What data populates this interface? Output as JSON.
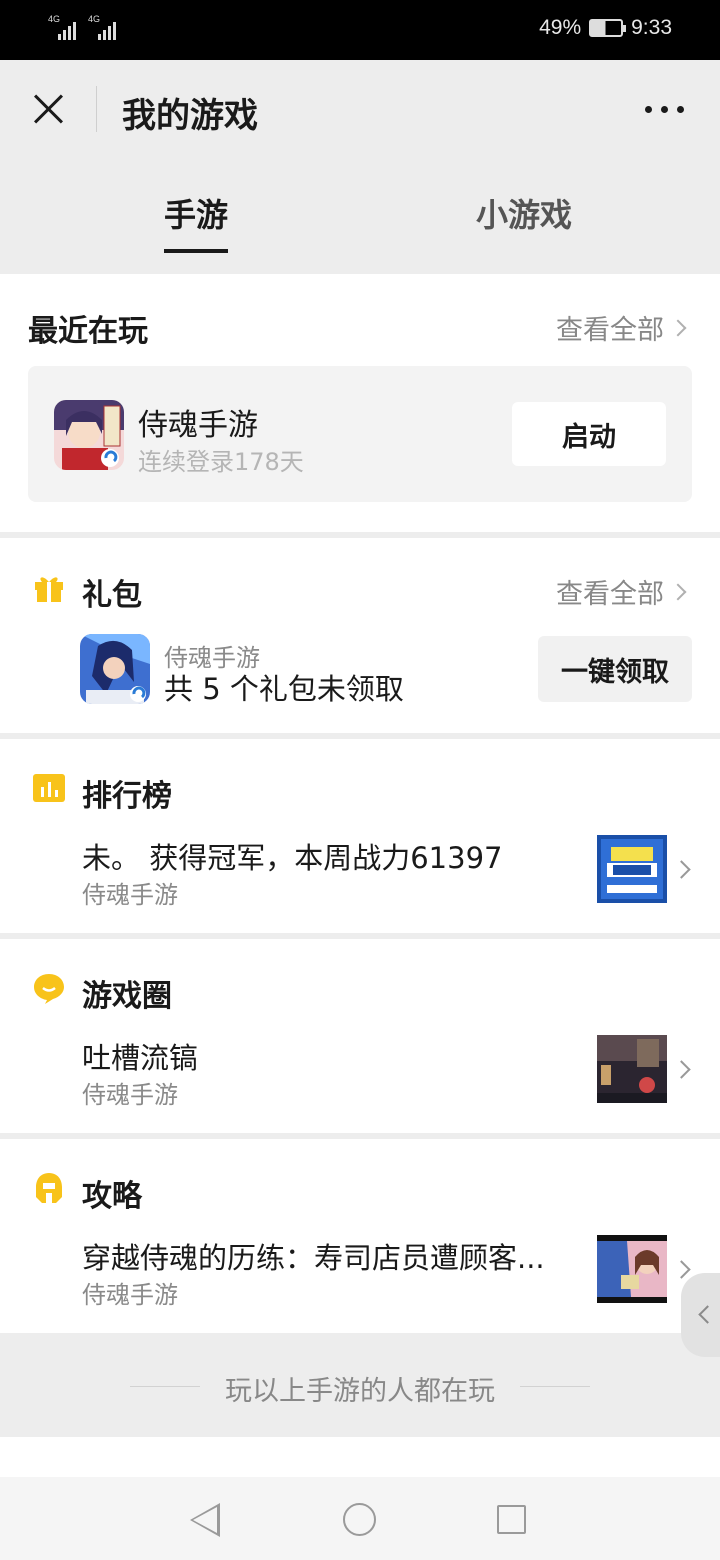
{
  "status_bar": {
    "signal1_label": "4G",
    "signal2_label": "4G",
    "battery": "49%",
    "time": "9:33"
  },
  "header": {
    "title": "我的游戏"
  },
  "tabs": [
    {
      "label": "手游",
      "active": true
    },
    {
      "label": "小游戏",
      "active": false
    }
  ],
  "recent": {
    "title": "最近在玩",
    "view_all": "查看全部",
    "game": {
      "name": "侍魂手游",
      "subtitle": "连续登录178天",
      "button": "启动"
    }
  },
  "gift": {
    "title": "礼包",
    "view_all": "查看全部",
    "game": "侍魂手游",
    "text": "共 5 个礼包未领取",
    "button": "一键领取"
  },
  "ranking": {
    "title": "排行榜",
    "main": "未。 获得冠军，本周战力61397",
    "sub": "侍魂手游"
  },
  "circle": {
    "title": "游戏圈",
    "main": "吐槽流镐",
    "sub": "侍魂手游"
  },
  "guide": {
    "title": "攻略",
    "main": "穿越侍魂的历练：寿司店员遭顾客...",
    "sub": "侍魂手游"
  },
  "recommend": {
    "text": "玩以上手游的人都在玩"
  },
  "colors": {
    "accent_yellow": "#f8c31a",
    "page_bg": "#ededed"
  }
}
